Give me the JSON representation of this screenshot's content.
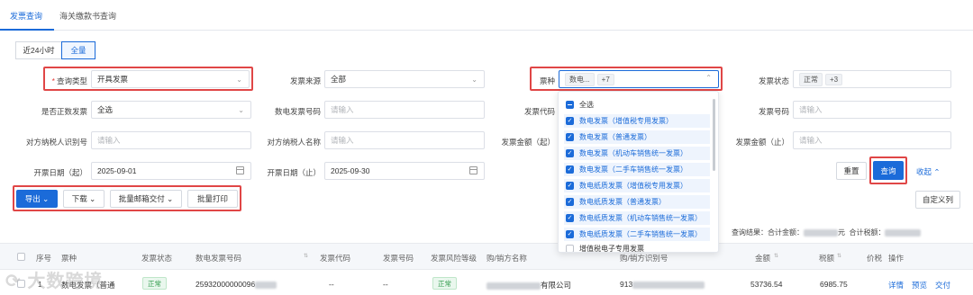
{
  "tabs": [
    "发票查询",
    "海关缴款书查询"
  ],
  "time_filter": {
    "options": [
      "近24小时",
      "全量"
    ],
    "selected": "全量"
  },
  "form": {
    "query_type": {
      "label": "查询类型",
      "value": "开具发票"
    },
    "invoice_source": {
      "label": "发票来源",
      "value": "全部"
    },
    "invoice_kind": {
      "label": "票种",
      "tags": [
        "数电...",
        "+7"
      ]
    },
    "invoice_status": {
      "label": "发票状态",
      "tags": [
        "正常",
        "+3"
      ]
    },
    "is_correction": {
      "label": "是否正数发票",
      "value": "全选"
    },
    "digital_invoice_no": {
      "label": "数电发票号码",
      "placeholder": "请输入"
    },
    "invoice_code": {
      "label": "发票代码"
    },
    "invoice_number": {
      "label": "发票号码",
      "placeholder": "请输入"
    },
    "counterparty_tax_id": {
      "label": "对方纳税人识别号",
      "placeholder": "请输入"
    },
    "counterparty_name": {
      "label": "对方纳税人名称",
      "placeholder": "请输入"
    },
    "amount_from": {
      "label": "发票金额（起）"
    },
    "amount_to": {
      "label": "发票金额（止）",
      "placeholder": "请输入"
    },
    "date_from": {
      "label": "开票日期（起）",
      "value": "2025-09-01"
    },
    "date_to": {
      "label": "开票日期（止）",
      "value": "2025-09-30"
    }
  },
  "dropdown": {
    "select_all": "全选",
    "items": [
      {
        "label": "数电发票（增值税专用发票）",
        "checked": true
      },
      {
        "label": "数电发票（普通发票）",
        "checked": true
      },
      {
        "label": "数电发票（机动车销售统一发票）",
        "checked": true
      },
      {
        "label": "数电发票（二手车销售统一发票）",
        "checked": true
      },
      {
        "label": "数电纸质发票（增值税专用发票）",
        "checked": true
      },
      {
        "label": "数电纸质发票（普通发票）",
        "checked": true
      },
      {
        "label": "数电纸质发票（机动车销售统一发票）",
        "checked": true
      },
      {
        "label": "数电纸质发票（二手车销售统一发票）",
        "checked": true
      },
      {
        "label": "增值税电子专用发票",
        "checked": false
      }
    ]
  },
  "actions": {
    "reset": "重置",
    "query": "查询",
    "collapse": "收起"
  },
  "toolbar": {
    "export": "导出",
    "download": "下载",
    "batch_mail": "批量邮箱交付",
    "batch_print": "批量打印",
    "custom_columns": "自定义列"
  },
  "summary": {
    "result_label": "查询结果：",
    "total_amount_label": "合计金额：",
    "total_amount_unit": "元",
    "total_tax_label": "合计税额："
  },
  "table": {
    "columns": [
      "序号",
      "票种",
      "发票状态",
      "数电发票号码",
      "发票代码",
      "发票号码",
      "发票风险等级",
      "购/销方名称",
      "购/销方识别号",
      "金额",
      "税额",
      "价税",
      "操作"
    ],
    "rows": [
      {
        "index": "1",
        "kind": "数电发票（普通",
        "status": "正常",
        "digital_no": "25932000000096",
        "code": "--",
        "number": "--",
        "risk": "正常",
        "buyer_name": "有限公司",
        "buyer_id": "913",
        "amount": "53736.54",
        "tax": "6985.75",
        "ops": [
          "详情",
          "预览",
          "交付"
        ]
      }
    ]
  },
  "watermark": "大数跨境",
  "colors": {
    "primary": "#1b6bd9",
    "highlight_box": "#e04646",
    "success": "#2e9b4a"
  }
}
